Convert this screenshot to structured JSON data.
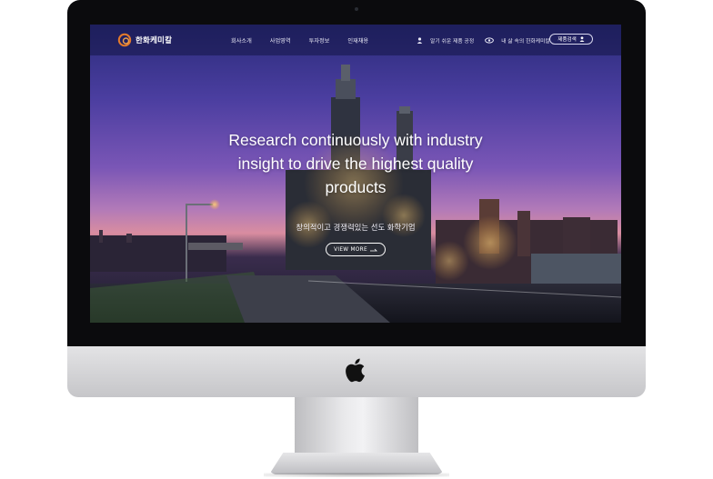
{
  "nav": {
    "logo_text": "한화케미칼",
    "menu": [
      "회사소개",
      "사업영역",
      "투자정보",
      "인재채용"
    ],
    "util_links": [
      "알기 쉬운 제품 공정",
      "내 삶 속의 한화케미칼"
    ],
    "search_label": "제품검색"
  },
  "hero": {
    "headline_lines": [
      "Research continuously with industry",
      "insight to drive the highest quality",
      "products"
    ],
    "subline": "창의적이고 경쟁력있는 선도 화학기업",
    "cta_label": "VIEW MORE"
  },
  "colors": {
    "accent": "#e37a2b",
    "nav_bg": "#14164a",
    "sky_top": "#2a2b7a",
    "sky_horizon": "#d98da0"
  },
  "icons": [
    "logo-mark-icon",
    "person-icon",
    "eye-icon",
    "user-icon",
    "arrow-right-icon",
    "apple-logo-icon"
  ]
}
